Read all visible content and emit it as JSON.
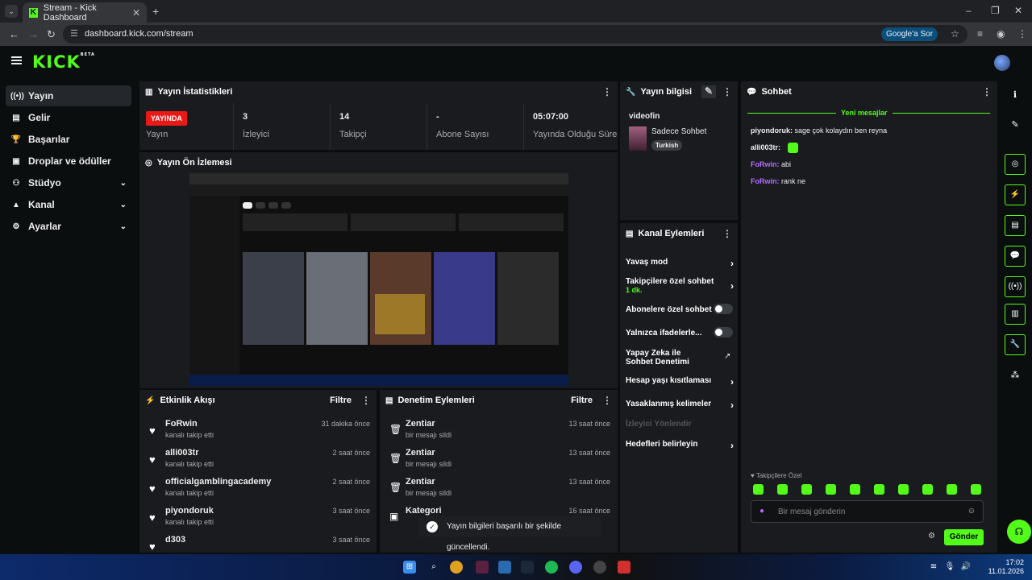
{
  "browser": {
    "tab_title": "Stream - Kick Dashboard",
    "url": "dashboard.kick.com/stream",
    "google_button": "Google'a Sor"
  },
  "brand": {
    "logo_text": "KICK",
    "beta": "BETA",
    "accent": "#53fc18"
  },
  "sidebar": {
    "items": [
      {
        "label": "Yayın",
        "icon": "broadcast-icon"
      },
      {
        "label": "Gelir",
        "icon": "revenue-icon"
      },
      {
        "label": "Başarılar",
        "icon": "trophy-icon"
      },
      {
        "label": "Droplar ve ödüller",
        "icon": "gift-icon"
      },
      {
        "label": "Stüdyo",
        "icon": "studio-icon"
      },
      {
        "label": "Kanal",
        "icon": "channel-icon"
      },
      {
        "label": "Ayarlar",
        "icon": "gear-icon"
      }
    ]
  },
  "stats": {
    "title": "Yayın İstatistikleri",
    "live_badge": "YAYINDA",
    "live_label": "Yayın",
    "viewers_value": "3",
    "viewers_label": "İzleyici",
    "followers_value": "14",
    "followers_label": "Takipçi",
    "subs_value": "-",
    "subs_label": "Abone Sayısı",
    "uptime_value": "05:07:00",
    "uptime_label": "Yayında Olduğu Süre"
  },
  "preview": {
    "title": "Yayın Ön İzlemesi"
  },
  "stream_info": {
    "title": "Yayın bilgisi",
    "stream_title": "videofin",
    "category": "Sadece Sohbet",
    "language_tag": "Turkish"
  },
  "channel_actions": {
    "title": "Kanal Eylemleri",
    "items": [
      {
        "label": "Yavaş mod"
      },
      {
        "label": "Takipçilere özel sohbet",
        "sub": "1 dk."
      },
      {
        "label": "Abonelere özel sohbet"
      },
      {
        "label": "Yalnızca ifadelerle..."
      },
      {
        "label": "Yapay Zeka ile Sohbet Denetimi"
      },
      {
        "label": "Hesap yaşı kısıtlaması"
      },
      {
        "label": "Yasaklanmış kelimeler"
      },
      {
        "label": "İzleyici Yönlendir"
      },
      {
        "label": "Hedefleri belirleyin"
      }
    ]
  },
  "event_feed": {
    "title": "Etkinlik Akışı",
    "filter": "Filtre",
    "items": [
      {
        "name": "FoRwin",
        "action": "kanalı takip etti",
        "time": "31 dakika önce"
      },
      {
        "name": "alli003tr",
        "action": "kanalı takip etti",
        "time": "2 saat önce"
      },
      {
        "name": "officialgamblingacademy",
        "action": "kanalı takip etti",
        "time": "2 saat önce"
      },
      {
        "name": "piyondoruk",
        "action": "kanalı takip etti",
        "time": "3 saat önce"
      },
      {
        "name": "d303",
        "action": "",
        "time": "3 saat önce"
      }
    ]
  },
  "moderation": {
    "title": "Denetim Eylemleri",
    "filter": "Filtre",
    "items": [
      {
        "name": "Zentiar",
        "action": "bir mesajı sildi",
        "time": "13 saat önce"
      },
      {
        "name": "Zentiar",
        "action": "bir mesajı sildi",
        "time": "13 saat önce"
      },
      {
        "name": "Zentiar",
        "action": "bir mesajı sildi",
        "time": "13 saat önce"
      },
      {
        "name": "Kategori",
        "action": "",
        "time": "16 saat önce"
      }
    ]
  },
  "chat": {
    "title": "Sohbet",
    "new_messages": "Yeni mesajlar",
    "messages": [
      {
        "user": "piyondoruk:",
        "text": "sage çok kolaydın ben reyna",
        "color": "#cccccc"
      },
      {
        "user": "alli003tr:",
        "text": "",
        "color": "#cccccc"
      },
      {
        "user": "FoRwin:",
        "text": "abi",
        "color": "#b36cff"
      },
      {
        "user": "FoRwin:",
        "text": "rank ne",
        "color": "#b36cff"
      }
    ],
    "followers_only": "Takipçilere Özel",
    "input_placeholder": "Bir mesaj gönderin",
    "send": "Gönder"
  },
  "toast": {
    "text": "Yayın bilgileri başarılı bir şekilde güncellendi."
  },
  "taskbar": {
    "time": "17:02",
    "date": "11.01.2026"
  }
}
